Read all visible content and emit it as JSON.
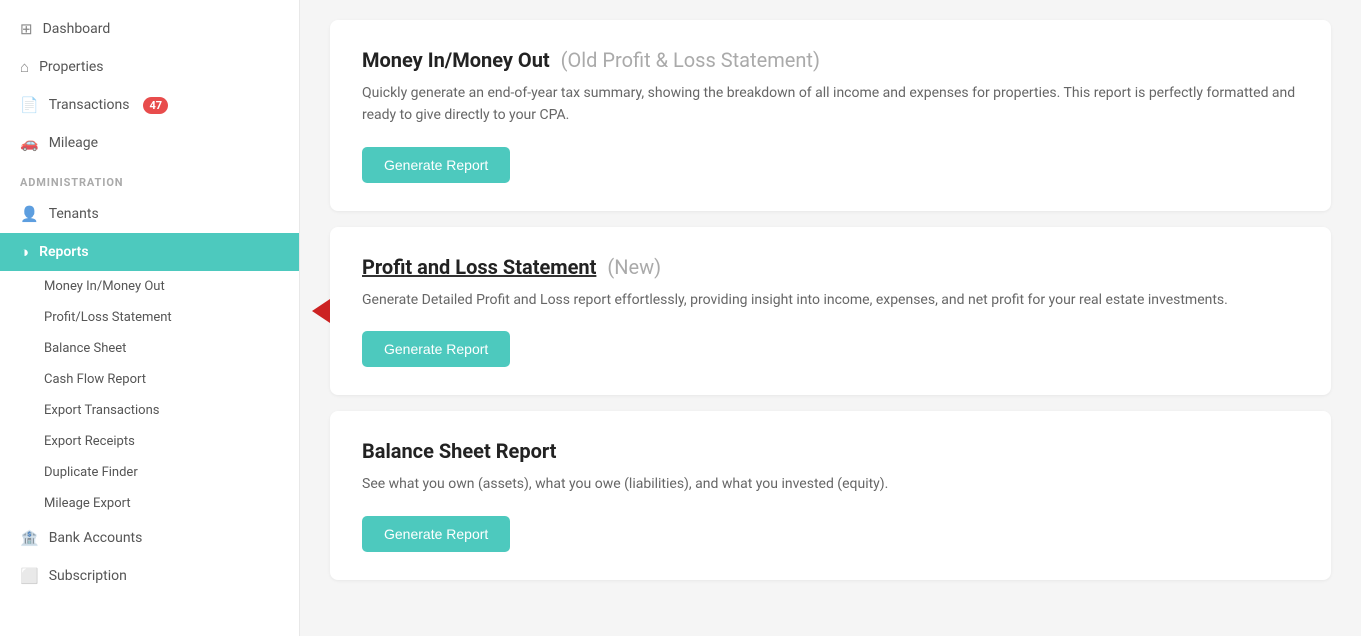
{
  "sidebar": {
    "items": [
      {
        "id": "dashboard",
        "label": "Dashboard",
        "icon": "🏠",
        "active": false
      },
      {
        "id": "properties",
        "label": "Properties",
        "icon": "🏠",
        "active": false
      },
      {
        "id": "transactions",
        "label": "Transactions",
        "icon": "📄",
        "active": false,
        "badge": "47"
      },
      {
        "id": "mileage",
        "label": "Mileage",
        "icon": "🚗",
        "active": false
      }
    ],
    "admin_label": "ADMINISTRATION",
    "admin_items": [
      {
        "id": "tenants",
        "label": "Tenants",
        "icon": "👥",
        "active": false
      },
      {
        "id": "reports",
        "label": "Reports",
        "icon": "📊",
        "active": true
      }
    ],
    "sub_items": [
      {
        "id": "money-in-money-out",
        "label": "Money In/Money Out"
      },
      {
        "id": "profit-loss",
        "label": "Profit/Loss Statement"
      },
      {
        "id": "balance-sheet",
        "label": "Balance Sheet"
      },
      {
        "id": "cash-flow",
        "label": "Cash Flow Report"
      },
      {
        "id": "export-transactions",
        "label": "Export Transactions"
      },
      {
        "id": "export-receipts",
        "label": "Export Receipts"
      },
      {
        "id": "duplicate-finder",
        "label": "Duplicate Finder"
      },
      {
        "id": "mileage-export",
        "label": "Mileage Export"
      }
    ],
    "bottom_items": [
      {
        "id": "bank-accounts",
        "label": "Bank Accounts",
        "icon": "🏦"
      },
      {
        "id": "subscription",
        "label": "Subscription",
        "icon": "💳"
      }
    ]
  },
  "reports": [
    {
      "id": "money-in-out",
      "title": "Money In/Money Out",
      "subtitle": "(Old Profit & Loss Statement)",
      "description": "Quickly generate an end-of-year tax summary, showing the breakdown of all income and expenses for properties. This report is perfectly formatted and ready to give directly to your CPA.",
      "button_label": "Generate Report",
      "show_arrow": false
    },
    {
      "id": "profit-loss",
      "title": "Profit and Loss Statement",
      "subtitle": "(New)",
      "description": "Generate Detailed Profit and Loss report effortlessly, providing insight into income, expenses, and net profit for your real estate investments.",
      "button_label": "Generate Report",
      "show_arrow": true
    },
    {
      "id": "balance-sheet",
      "title": "Balance Sheet Report",
      "subtitle": "",
      "description": "See what you own (assets), what you owe (liabilities), and what you invested (equity).",
      "button_label": "Generate Report",
      "show_arrow": false
    }
  ]
}
